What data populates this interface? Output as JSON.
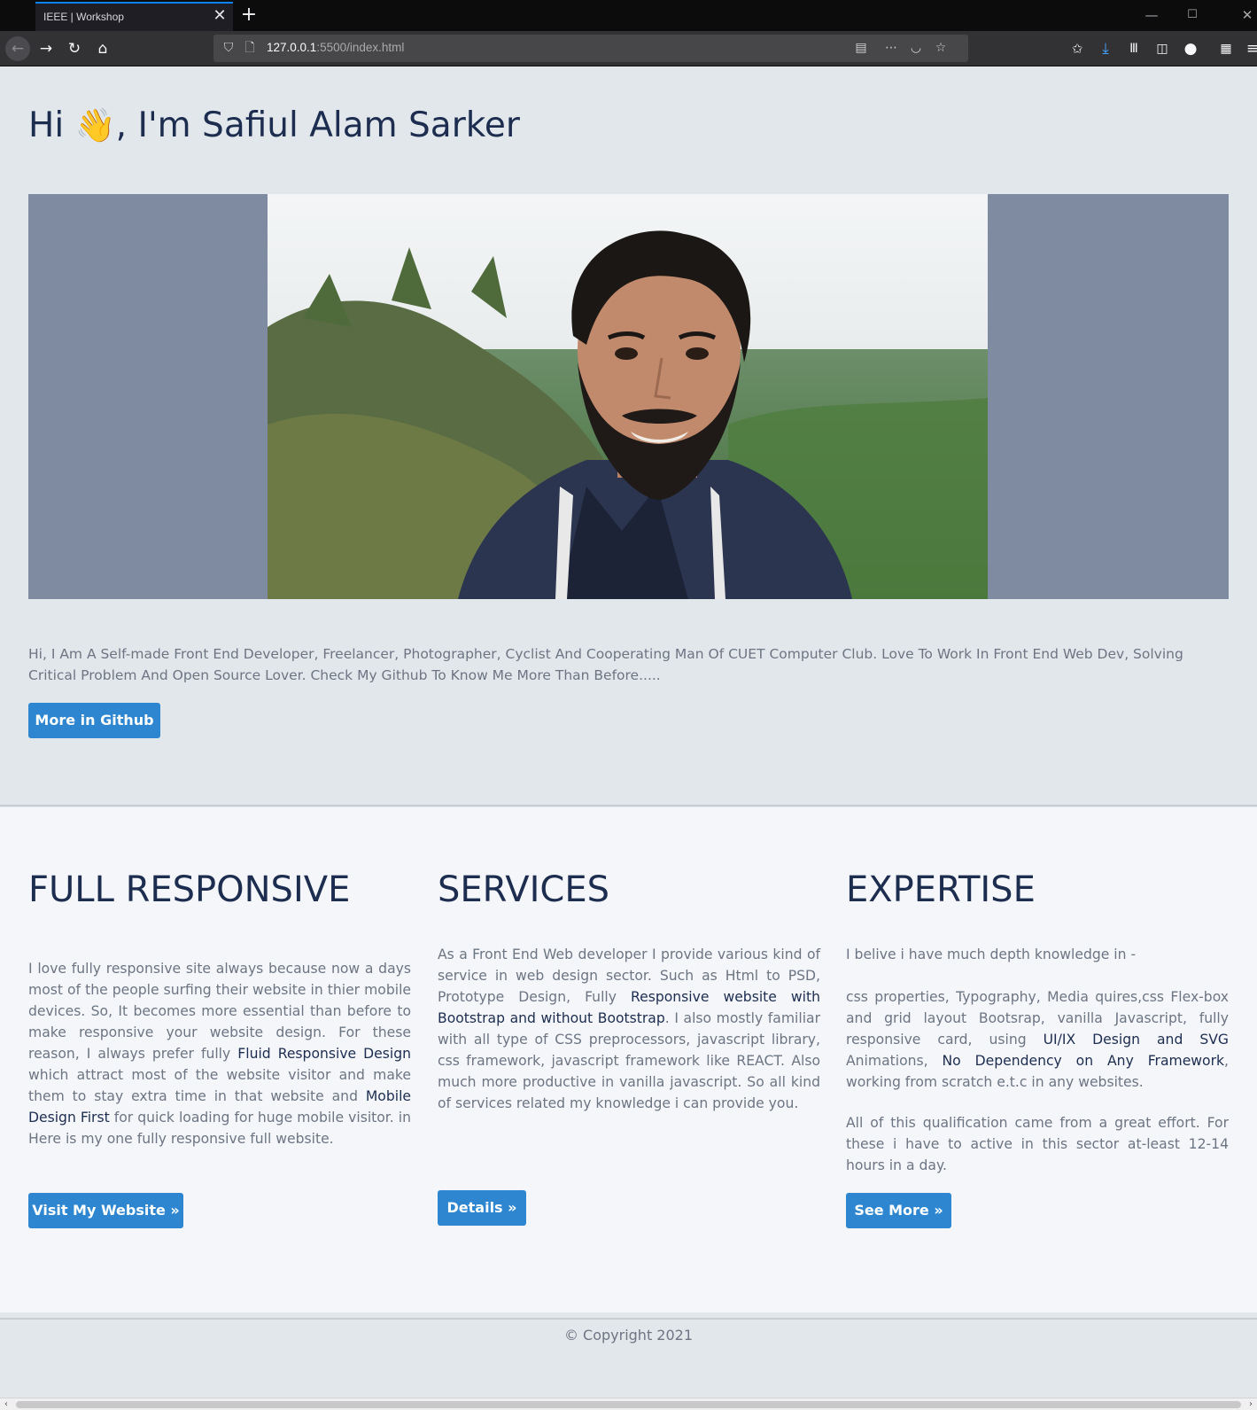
{
  "browser": {
    "tab_title": "IEEE | Workshop",
    "url_host": "127.0.0.1",
    "url_path": ":5500/index.html"
  },
  "hero": {
    "greeting": "Hi",
    "wave_emoji": "👋",
    "name_text": ", I'm Safiul Alam Sarker",
    "bio": "Hi, I Am A Self-made Front End Developer, Freelancer, Photographer, Cyclist And Cooperating Man Of CUET Computer Club. Love To Work In Front End Web Dev, Solving Critical Problem And Open Source Lover. Check My Github To Know Me More Than Before.....",
    "github_button": "More in Github"
  },
  "features": {
    "responsive": {
      "title": "FULL RESPONSIVE",
      "text_1": "I love fully responsive site always because now a days most of the people surfing their website in thier mobile devices. So, It becomes more essential than before to make responsive your website design. For these reason, I always prefer fully ",
      "em_1": "Fluid Responsive Design",
      "text_2": " which attract most of the website visitor and make them to stay extra time in that website and ",
      "em_2": "Mobile Design First",
      "text_3": " for quick loading for huge mobile visitor. in Here is my one fully responsive full website.",
      "button": "Visit My Website »"
    },
    "services": {
      "title": "SERVICES",
      "text_1": "As a Front End Web developer I provide various kind of service in web design sector. Such as Html to PSD, Prototype Design, Fully ",
      "em_1": "Responsive website with Bootstrap and without Bootstrap",
      "text_2": ". I also mostly familiar with all type of CSS preprocessors, javascript library, css framework, javascript framework like REACT. Also much more productive in vanilla javascript. So all kind of services related my knowledge i can provide you.",
      "button": "Details »"
    },
    "expertise": {
      "title": "EXPERTISE",
      "intro": "I belive i have much depth knowledge in -",
      "text_1": "css properties, Typography, Media quires,css Flex-box and grid layout Bootsrap, vanilla Javascript, fully responsive card, using ",
      "em_1": "UI/IX Design and SVG",
      "text_2": " Animations, ",
      "em_2": "No Dependency on Any Framework",
      "text_3": ", working from scratch e.t.c in any websites.",
      "para_2": "All of this qualification came from a great effort. For these i have to active in this sector at-least 12-14 hours in a day.",
      "button": "See More »"
    }
  },
  "footer": {
    "copyright": "© Copyright 2021"
  },
  "colors": {
    "heading": "#1d2d50",
    "body_text": "#6d7583",
    "button": "#2e86d1",
    "page_bg": "#e2e7ec",
    "features_bg": "#f4f6fa",
    "photo_frame": "#7e8ba1"
  }
}
